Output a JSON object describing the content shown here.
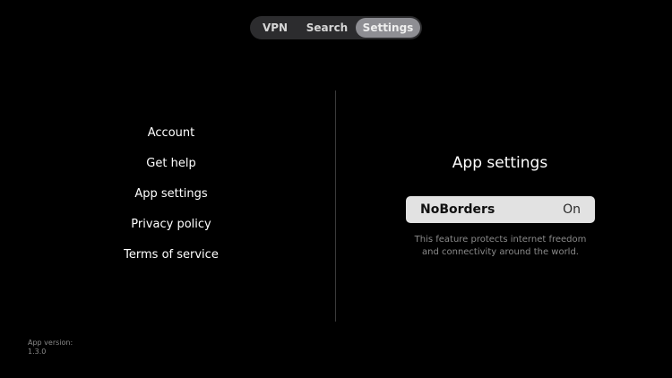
{
  "tabs": [
    {
      "label": "VPN",
      "selected": false
    },
    {
      "label": "Search",
      "selected": false
    },
    {
      "label": "Settings",
      "selected": true
    }
  ],
  "menu": [
    {
      "label": "Account"
    },
    {
      "label": "Get help"
    },
    {
      "label": "App settings"
    },
    {
      "label": "Privacy policy"
    },
    {
      "label": "Terms of service"
    }
  ],
  "panel": {
    "title": "App settings",
    "setting": {
      "label": "NoBorders",
      "value": "On",
      "description": "This feature protects internet freedom and connectivity around the world."
    }
  },
  "footer": {
    "version_label": "App version:",
    "version_number": "1.3.0"
  },
  "colors": {
    "background": "#000000",
    "tab_bar": "#2c2c2e",
    "tab_selected": "#8e8e93",
    "setting_row": "#e2e2e2",
    "muted_text": "#8a8a8a"
  }
}
